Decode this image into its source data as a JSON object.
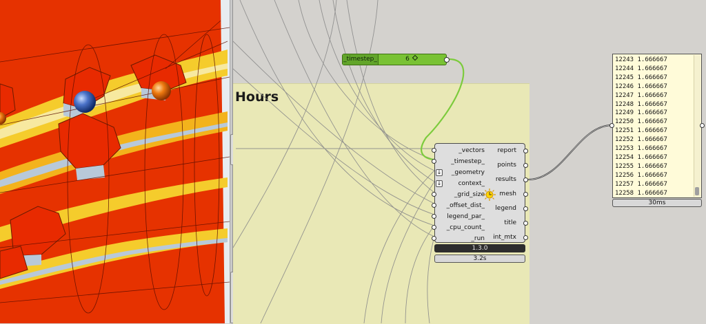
{
  "group": {
    "title": "Hours"
  },
  "slider": {
    "name": "_timestep_",
    "value": "6"
  },
  "component": {
    "inputs": [
      "_vectors",
      "_timestep_",
      "_geometry",
      "context_",
      "_grid_size",
      "_offset_dist_",
      "legend_par_",
      "_cpu_count_",
      "_run"
    ],
    "outputs": [
      "report",
      "points",
      "results",
      "mesh",
      "legend",
      "title",
      "int_mtx"
    ],
    "version": "1.3.0",
    "time": "3.2s"
  },
  "panel": {
    "rows": [
      "12243 1.666667",
      "12244 1.666667",
      "12245 1.666667",
      "12246 1.666667",
      "12247 1.666667",
      "12248 1.666667",
      "12249 1.666667",
      "12250 1.666667",
      "12251 1.666667",
      "12252 1.666667",
      "12253 1.666667",
      "12254 1.666667",
      "12255 1.666667",
      "12256 1.666667",
      "12257 1.666667",
      "12258 1.666667"
    ],
    "time": "30ms"
  },
  "colors": {
    "canvas": "#d4d2ce",
    "group_fill": "#e9e8b6",
    "slider": "#79c234",
    "selected_wire": "#7ccb3c",
    "panel_fill": "#fffbd9",
    "heat_red": "#e63200",
    "heat_yellow": "#f5cc2c"
  },
  "icons": [
    "sun-icon",
    "flatten-arrow-icon",
    "diamond-icon"
  ]
}
